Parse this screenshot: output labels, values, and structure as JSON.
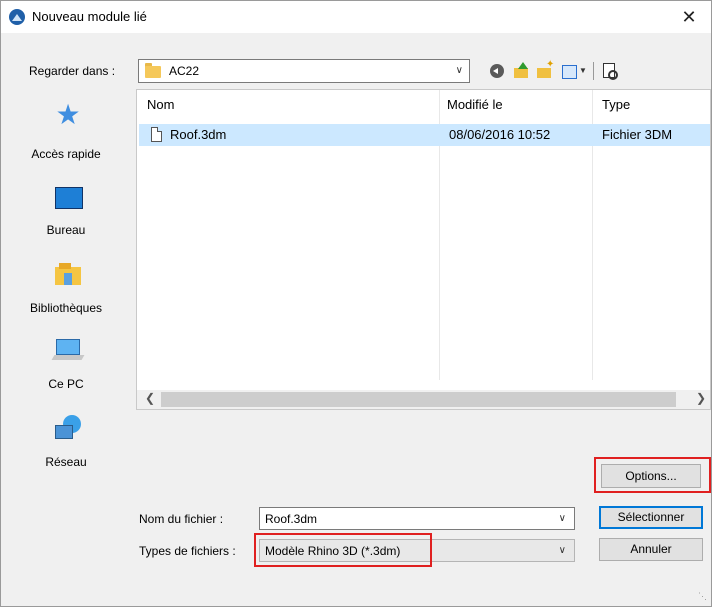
{
  "window": {
    "title": "Nouveau module lié",
    "close_glyph": "✕"
  },
  "lookin": {
    "label": "Regarder dans :",
    "value": "AC22"
  },
  "toolbar": {
    "icons": [
      "back-icon",
      "up-folder-icon",
      "new-folder-icon",
      "view-menu-icon",
      "preview-icon"
    ]
  },
  "sidebar": {
    "items": [
      {
        "label": "Accès rapide",
        "icon": "quick-access-star-icon"
      },
      {
        "label": "Bureau",
        "icon": "desktop-icon"
      },
      {
        "label": "Bibliothèques",
        "icon": "libraries-icon"
      },
      {
        "label": "Ce PC",
        "icon": "this-pc-icon"
      },
      {
        "label": "Réseau",
        "icon": "network-icon"
      }
    ]
  },
  "filelist": {
    "columns": [
      "Nom",
      "Modifié le",
      "Type"
    ],
    "rows": [
      {
        "name": "Roof.3dm",
        "modified": "08/06/2016 10:52",
        "type": "Fichier 3DM",
        "selected": true
      }
    ]
  },
  "form": {
    "filename_label": "Nom du fichier :",
    "filename_value": "Roof.3dm",
    "filetypes_label": "Types de fichiers :",
    "filetypes_value": "Modèle Rhino 3D (*.3dm)"
  },
  "buttons": {
    "options": "Options...",
    "select": "Sélectionner",
    "cancel": "Annuler"
  },
  "colors": {
    "selection": "#cce8ff",
    "highlight_box": "#e02020",
    "default_button_border": "#0078d7"
  }
}
